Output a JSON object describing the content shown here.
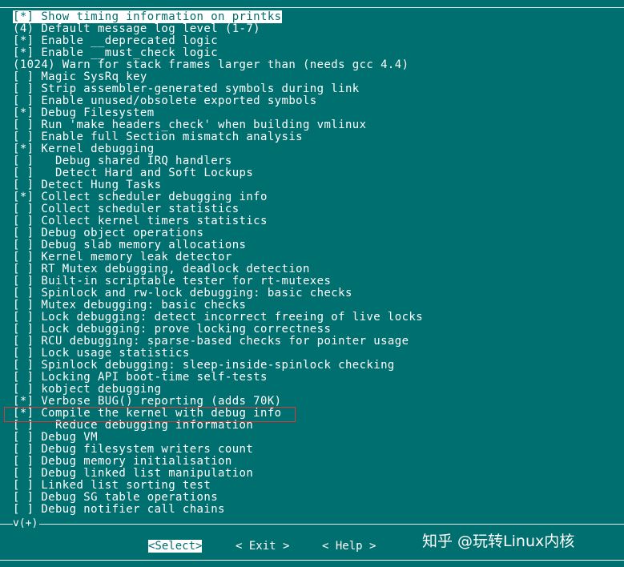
{
  "menu": {
    "items": [
      {
        "mark": "[*]",
        "label": "Show timing information on printks"
      },
      {
        "mark": "(4)",
        "label": "Default message log level (1-7)"
      },
      {
        "mark": "[*]",
        "label": "Enable __deprecated logic"
      },
      {
        "mark": "[*]",
        "label": "Enable __must_check logic"
      },
      {
        "mark": "(1024)",
        "label": "Warn for stack frames larger than (needs gcc 4.4)"
      },
      {
        "mark": "[ ]",
        "label": "Magic SysRq key"
      },
      {
        "mark": "[ ]",
        "label": "Strip assembler-generated symbols during link"
      },
      {
        "mark": "[ ]",
        "label": "Enable unused/obsolete exported symbols"
      },
      {
        "mark": "[*]",
        "label": "Debug Filesystem"
      },
      {
        "mark": "[ ]",
        "label": "Run 'make headers_check' when building vmlinux"
      },
      {
        "mark": "[ ]",
        "label": "Enable full Section mismatch analysis"
      },
      {
        "mark": "[*]",
        "label": "Kernel debugging"
      },
      {
        "mark": "[ ]",
        "label": "  Debug shared IRQ handlers"
      },
      {
        "mark": "[ ]",
        "label": "  Detect Hard and Soft Lockups"
      },
      {
        "mark": "[ ]",
        "label": "Detect Hung Tasks"
      },
      {
        "mark": "[*]",
        "label": "Collect scheduler debugging info"
      },
      {
        "mark": "[ ]",
        "label": "Collect scheduler statistics"
      },
      {
        "mark": "[ ]",
        "label": "Collect kernel timers statistics"
      },
      {
        "mark": "[ ]",
        "label": "Debug object operations"
      },
      {
        "mark": "[ ]",
        "label": "Debug slab memory allocations"
      },
      {
        "mark": "[ ]",
        "label": "Kernel memory leak detector"
      },
      {
        "mark": "[ ]",
        "label": "RT Mutex debugging, deadlock detection"
      },
      {
        "mark": "[ ]",
        "label": "Built-in scriptable tester for rt-mutexes"
      },
      {
        "mark": "[ ]",
        "label": "Spinlock and rw-lock debugging: basic checks"
      },
      {
        "mark": "[ ]",
        "label": "Mutex debugging: basic checks"
      },
      {
        "mark": "[ ]",
        "label": "Lock debugging: detect incorrect freeing of live locks"
      },
      {
        "mark": "[ ]",
        "label": "Lock debugging: prove locking correctness"
      },
      {
        "mark": "[ ]",
        "label": "RCU debugging: sparse-based checks for pointer usage"
      },
      {
        "mark": "[ ]",
        "label": "Lock usage statistics"
      },
      {
        "mark": "[ ]",
        "label": "Spinlock debugging: sleep-inside-spinlock checking"
      },
      {
        "mark": "[ ]",
        "label": "Locking API boot-time self-tests"
      },
      {
        "mark": "[ ]",
        "label": "kobject debugging"
      },
      {
        "mark": "[*]",
        "label": "Verbose BUG() reporting (adds 70K)"
      },
      {
        "mark": "[*]",
        "label": "Compile the kernel with debug info"
      },
      {
        "mark": "[ ]",
        "label": "  Reduce debugging information"
      },
      {
        "mark": "[ ]",
        "label": "Debug VM"
      },
      {
        "mark": "[ ]",
        "label": "Debug filesystem writers count"
      },
      {
        "mark": "[ ]",
        "label": "Debug memory initialisation"
      },
      {
        "mark": "[ ]",
        "label": "Debug linked list manipulation"
      },
      {
        "mark": "[ ]",
        "label": "Linked list sorting test"
      },
      {
        "mark": "[ ]",
        "label": "Debug SG table operations"
      },
      {
        "mark": "[ ]",
        "label": "Debug notifier call chains"
      }
    ],
    "selected_index": 0,
    "scroll_indicator": "v(+)"
  },
  "buttons": {
    "select": "<Select>",
    "exit": "< Exit >",
    "help": "< Help >"
  },
  "watermark": "知乎 @玩转Linux内核",
  "colors": {
    "background": "#006f6f",
    "text": "#ffffff",
    "highlight_box": "#d63a3a"
  }
}
